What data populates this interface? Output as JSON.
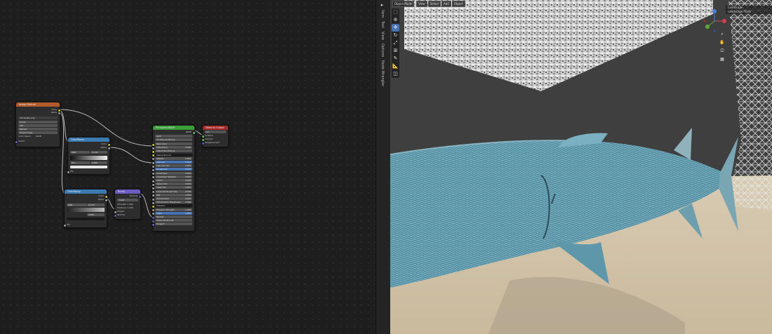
{
  "node_editor": {
    "image_texture": {
      "title": "Image Texture",
      "outputs": [
        "Color",
        "Alpha"
      ],
      "image_name": "Landscape.png",
      "interpolation": "Linear",
      "projection": "Flat",
      "extension": "Repeat",
      "source": "Single Image",
      "color_space_label": "Color Space",
      "color_space_value": "sRGB",
      "vector_label": "Vector"
    },
    "color_ramp": {
      "title": "ColorRamp",
      "outputs": [
        "Color",
        "Alpha"
      ],
      "mode": "RGB",
      "interp": "Linear",
      "pos_label": "Pos",
      "pos_value": "0.000",
      "fac_label": "Fac"
    },
    "principled": {
      "title": "Principled BSDF",
      "output": "BSDF",
      "distribution": "GGX",
      "subsurface_method": "Christensen-Burley",
      "rows": [
        "Base Color",
        "Subsurface",
        "Subsurface Radius",
        "Subsurface Col",
        "Metallic",
        "Specular",
        "Specular Tint",
        "Roughness",
        "Anisotropic",
        "Anisotropic Rotation",
        "Sheen",
        "Sheen Tint",
        "Clearcoat",
        "Clearcoat Roughness",
        "IOR",
        "Transmission",
        "Transmission Roughness",
        "Emission",
        "Emission Strength",
        "Alpha",
        "Normal",
        "Clearcoat Normal",
        "Tangent"
      ],
      "values": [
        "",
        "0.000",
        "",
        "",
        "0.000",
        "0.500",
        "0.000",
        "0.500",
        "0.000",
        "0.000",
        "0.000",
        "0.500",
        "0.000",
        "0.030",
        "1.450",
        "0.000",
        "0.000",
        "",
        "1.000",
        "1.000",
        "",
        "",
        ""
      ]
    },
    "material_output": {
      "title": "Material Output",
      "target": "All",
      "inputs": [
        "Surface",
        "Volume",
        "Displacement"
      ]
    },
    "color_ramp2": {
      "title": "ColorRamp",
      "outputs": [
        "Color",
        "Alpha"
      ],
      "mode": "RGB",
      "interp": "Linear",
      "pos_value": "0.000",
      "fac_label": "Fac"
    },
    "bump": {
      "title": "Bump",
      "output": "Normal",
      "invert": "Invert",
      "strength_label": "Strength",
      "strength_value": "1.000",
      "distance_label": "Distance",
      "distance_value": "1.000",
      "height_label": "Height",
      "normal_label": "Normal"
    }
  },
  "side_tabs": [
    "Item",
    "Tool",
    "View",
    "Options",
    "Node Wrangler"
  ],
  "viewport": {
    "mode": "Object Mode",
    "menus": [
      "View",
      "Select",
      "Add",
      "Object"
    ],
    "overlay_lines": [
      "User Perspective",
      "(1) Landscape Base"
    ],
    "outliner": [
      "Landscape",
      "Landscape Trails"
    ],
    "tools": [
      "cursor-select",
      "cursor",
      "move",
      "rotate",
      "scale",
      "transform",
      "annotate",
      "measure",
      "add-cube"
    ]
  },
  "colors": {
    "image_texture_header": "#b15c2a",
    "color_ramp_header": "#3b7ab3",
    "principled_header": "#3b9e3b",
    "material_output_header": "#a82a2a",
    "bump_header": "#6a5cc0",
    "accent": "#4772b3"
  }
}
